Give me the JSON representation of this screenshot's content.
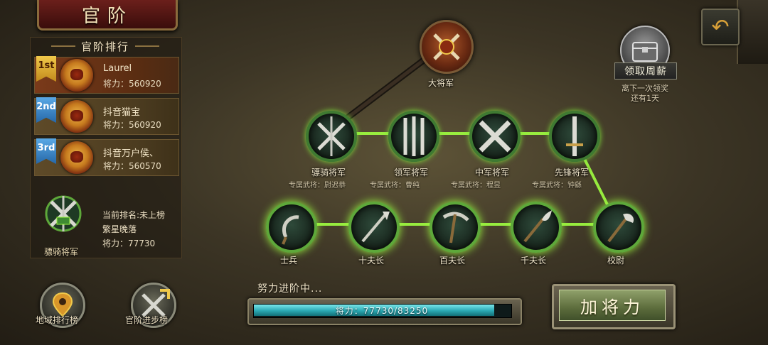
{
  "title": "官阶",
  "ranking": {
    "header": "官阶排行",
    "entries": [
      {
        "rank_badge": "1st",
        "name": "Laurel",
        "power": "将力：560920"
      },
      {
        "rank_badge": "2nd",
        "name": "抖音猫宝",
        "power": "将力：560920"
      },
      {
        "rank_badge": "3rd",
        "name": "抖音万户侯、",
        "power": "将力：560570"
      }
    ],
    "current": {
      "rank_title": "骠骑将军",
      "rank_line": "当前排名:未上榜",
      "name": "繁星晚落",
      "power": "将力：77730"
    }
  },
  "bottom_buttons": {
    "region_rank": "地域排行榜",
    "rank_progress": "官阶进步榜"
  },
  "tree": {
    "top": {
      "name": "大将军"
    },
    "middle": [
      {
        "name": "骠骑将军",
        "sub": "专属武将：尉迟恭"
      },
      {
        "name": "领军将军",
        "sub": "专属武将：曹纯"
      },
      {
        "name": "中军将军",
        "sub": "专属武将：程昱"
      },
      {
        "name": "先锋将军",
        "sub": "专属武将：钟繇"
      }
    ],
    "bottom": [
      {
        "name": "士兵"
      },
      {
        "name": "十夫长"
      },
      {
        "name": "百夫长"
      },
      {
        "name": "千夫长"
      },
      {
        "name": "校尉"
      }
    ]
  },
  "salary": {
    "label": "领取周薪",
    "note_line1": "离下一次领奖",
    "note_line2": "还有1天"
  },
  "progress": {
    "status": "努力进阶中...",
    "text": "将力：77730/83250",
    "current": 77730,
    "max": 83250
  },
  "add_power_label": "加将力",
  "colors": {
    "path_active": "#9cf540",
    "progress_fill": "#2aa8b2",
    "accent_red": "#6b1f1b"
  }
}
